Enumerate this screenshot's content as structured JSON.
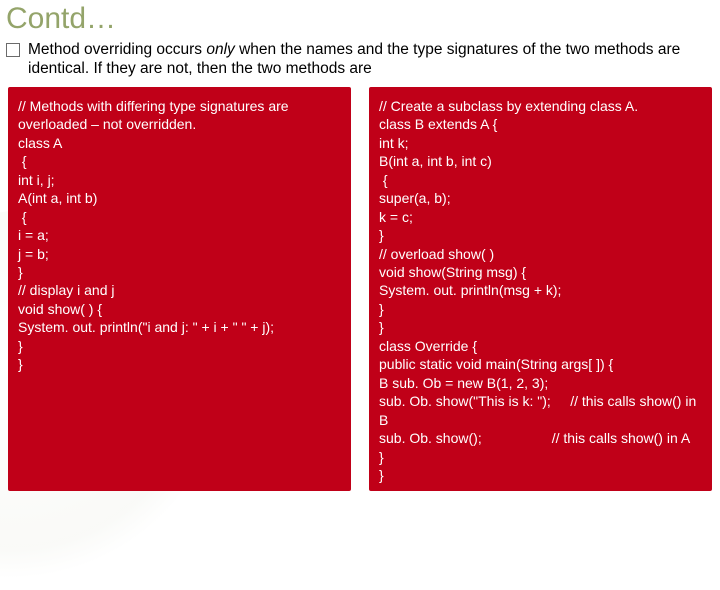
{
  "title": "Contd…",
  "bullet_html": "Method overriding occurs <em>only</em> when the names and the type signatures of the two methods are identical. If they are not, then the two methods are",
  "left": {
    "lines": [
      "// Methods with differing type signatures are overloaded – not overridden.",
      "class A",
      " {",
      "int i, j;",
      "A(int a, int b)",
      " {",
      "i = a;",
      "j = b;",
      "}",
      "// display i and j",
      "void show( ) {",
      "System. out. println(\"i and j: \" + i + \" \" + j);",
      "}",
      "}"
    ]
  },
  "right": {
    "lines": [
      "// Create a subclass by extending class A.",
      "class B extends A {",
      "int k;",
      "B(int a, int b, int c)",
      " {",
      "super(a, b);",
      "k = c;",
      "}",
      "// overload show( )",
      "void show(String msg) {",
      "System. out. println(msg + k);",
      "}",
      "}",
      "class Override {",
      "public static void main(String args[ ]) {",
      "B sub. Ob = new B(1, 2, 3);",
      "sub. Ob. show(\"This is k: \");     // this calls show() in B",
      "sub. Ob. show();                  // this calls show() in A",
      "}",
      "}"
    ]
  }
}
